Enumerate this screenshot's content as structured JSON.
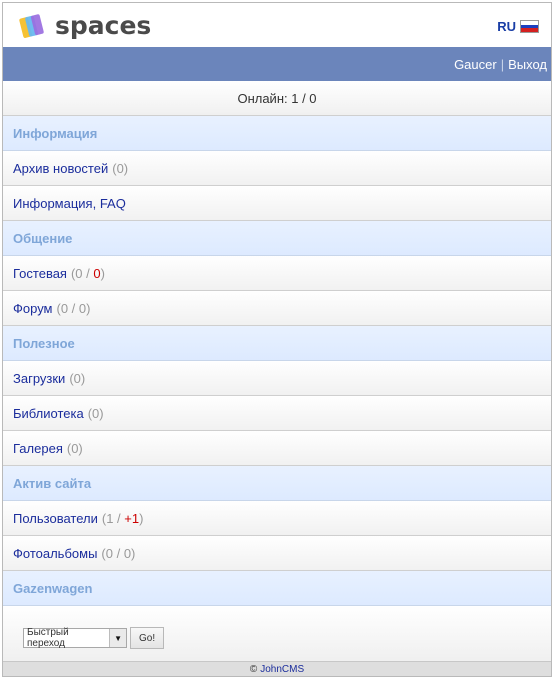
{
  "header": {
    "logo_text": "spaces",
    "lang_label": "RU",
    "flag_colors": [
      "#ffffff",
      "#1c3fbf",
      "#d42020"
    ]
  },
  "userbar": {
    "username": "Gaucer",
    "separator": "|",
    "logout": "Выход"
  },
  "online": "Онлайн: 1 / 0",
  "sections": [
    {
      "title": "Информация",
      "items": [
        {
          "label": "Архив новостей",
          "count": "(0)"
        },
        {
          "label": "Информация, FAQ"
        }
      ]
    },
    {
      "title": "Общение",
      "items": [
        {
          "label": "Гостевая",
          "count_pre": "(0 / ",
          "count_hl": "0",
          "count_post": ")"
        },
        {
          "label": "Форум",
          "count": "(0 / 0)"
        }
      ]
    },
    {
      "title": "Полезное",
      "items": [
        {
          "label": "Загрузки",
          "count": "(0)"
        },
        {
          "label": "Библиотека",
          "count": "(0)"
        },
        {
          "label": "Галерея",
          "count": "(0)"
        }
      ]
    },
    {
      "title": "Актив сайта",
      "items": [
        {
          "label": "Пользователи",
          "count_pre": "(1 / ",
          "count_hl": "+1",
          "count_post": ")"
        },
        {
          "label": "Фотоальбомы",
          "count": "(0 / 0)"
        }
      ]
    },
    {
      "title": "Gazenwagen",
      "items": []
    }
  ],
  "quick_jump": {
    "selected": "Быстрый переход",
    "go_label": "Go!"
  },
  "footer": {
    "symbol": "©",
    "link": "JohnCMS"
  },
  "colors": {
    "accent_bar": "#6b85bb",
    "link": "#1b2d9c",
    "section_text": "#7fa6d8",
    "highlight": "#cc0000"
  }
}
